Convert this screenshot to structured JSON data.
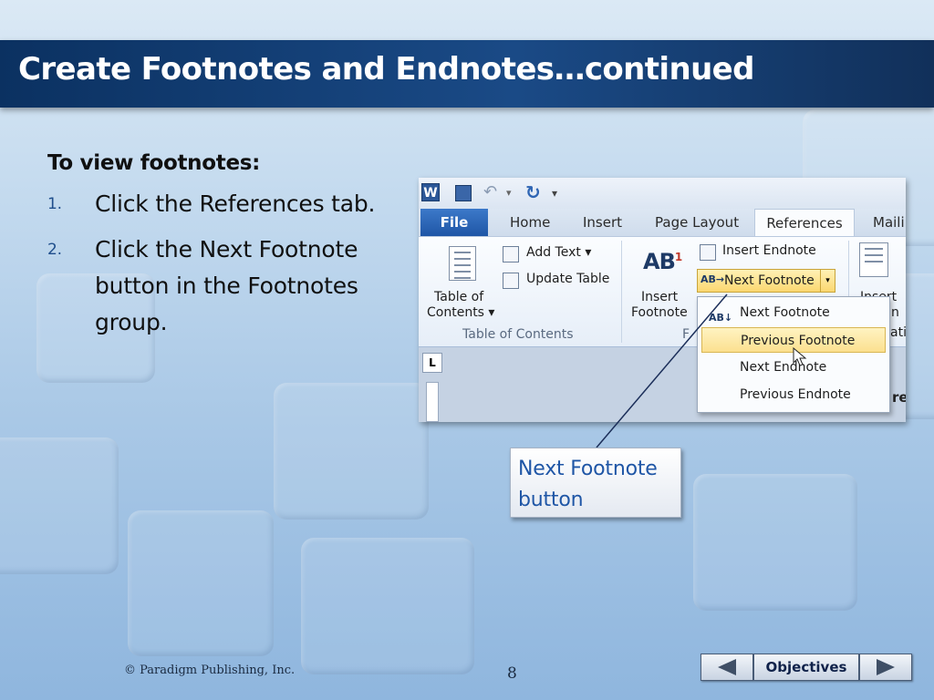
{
  "slide": {
    "title": "Create Footnotes and Endnotes…continued",
    "heading": "To view footnotes:",
    "steps": [
      {
        "number": "1.",
        "text": "Click the References tab."
      },
      {
        "number": "2.",
        "text": "Click the Next Footnote button in the Footnotes group."
      }
    ]
  },
  "screenshot": {
    "tabs": [
      "File",
      "Home",
      "Insert",
      "Page Layout",
      "References",
      "Maili"
    ],
    "toc": {
      "line1": "Table of",
      "line2": "Contents",
      "group_label": "Table of Contents"
    },
    "add_text": "Add Text",
    "update_table": "Update Table",
    "insert_endnote": "Insert Endnote",
    "next_footnote": "Next Footnote",
    "insert_footnote": {
      "line1": "Insert",
      "line2": "Footnote"
    },
    "ab_label": "AB",
    "ab_superscript": "1",
    "group_label_cut": "F",
    "right_cut": {
      "line1": "Insert",
      "line2": "n",
      "line3": "ati"
    },
    "menu_items": [
      "Next Footnote",
      "Previous Footnote",
      "Next Endnote",
      "Previous Endnote"
    ],
    "ruler_tab": "L",
    "doc_text_cut": "re"
  },
  "callout": {
    "text": "Next Footnote button"
  },
  "footer": {
    "copyright": "© Paradigm Publishing, Inc.",
    "page_number": "8",
    "objectives_label": "Objectives"
  },
  "colors": {
    "title_bar": "#0b3161",
    "callout_text": "#1f56a6",
    "highlight": "#fbd770"
  }
}
